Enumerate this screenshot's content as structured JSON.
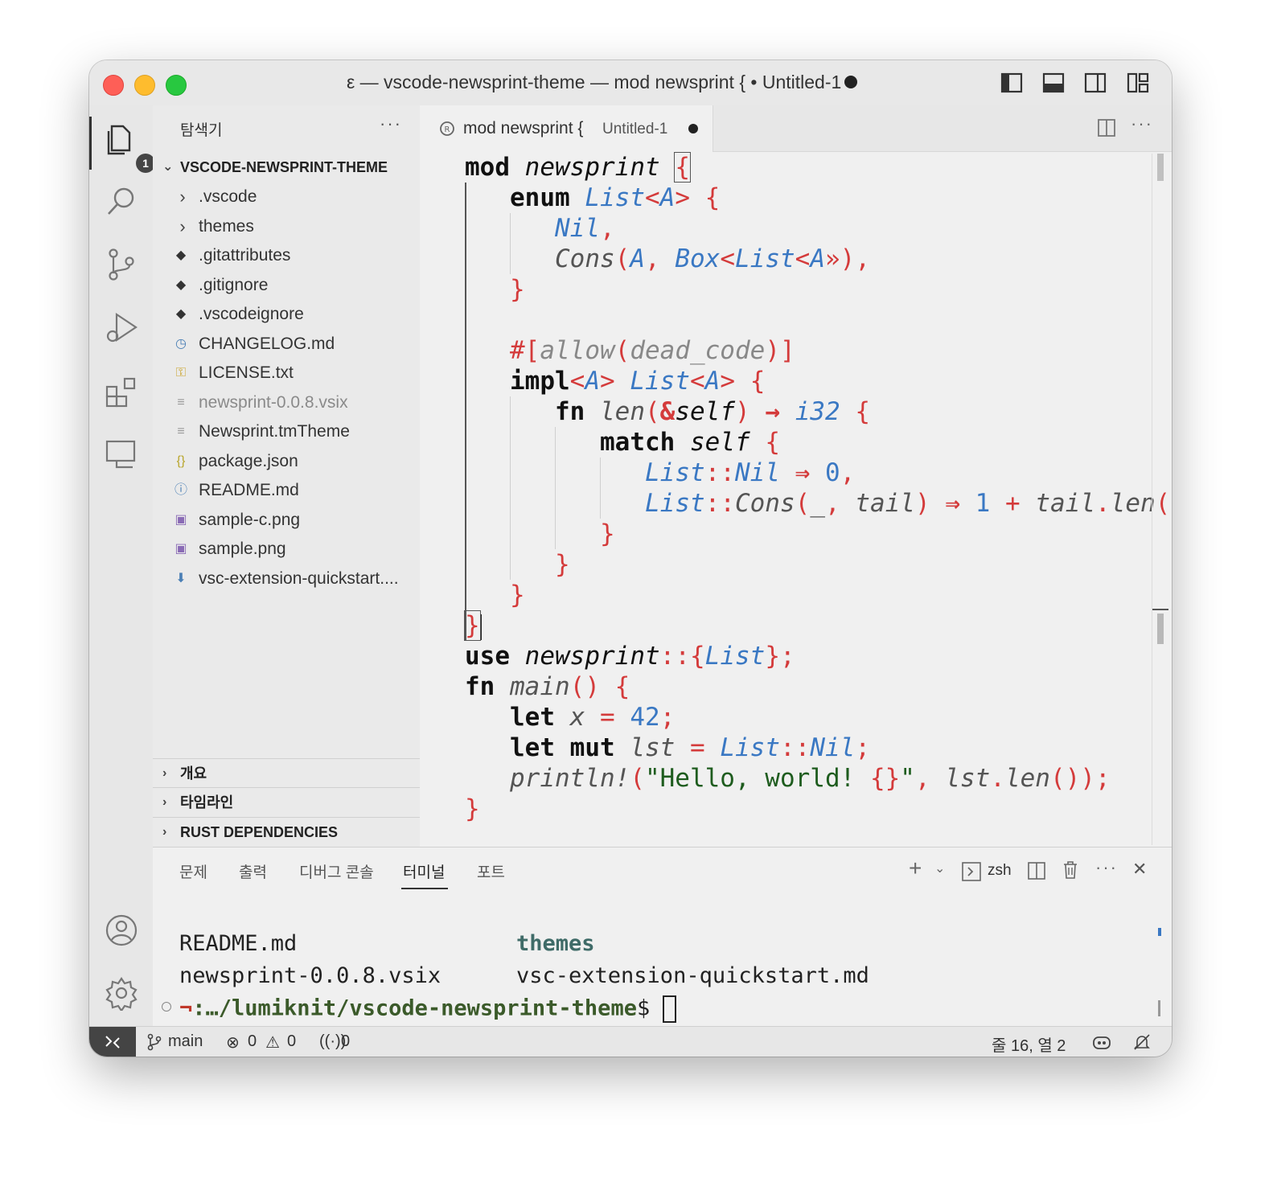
{
  "window": {
    "title": "ε — vscode-newsprint-theme — mod newsprint { • Untitled-1"
  },
  "activity_bar": {
    "explorer_badge": "1"
  },
  "sidebar": {
    "header": "탐색기",
    "more": "···",
    "project_title": "VSCODE-NEWSPRINT-THEME",
    "items": [
      {
        "label": ".vscode",
        "icon": "chevron-right-icon"
      },
      {
        "label": "themes",
        "icon": "chevron-right-icon"
      },
      {
        "label": ".gitattributes",
        "icon": "git-icon"
      },
      {
        "label": ".gitignore",
        "icon": "git-icon"
      },
      {
        "label": ".vscodeignore",
        "icon": "git-icon"
      },
      {
        "label": "CHANGELOG.md",
        "icon": "clock-icon"
      },
      {
        "label": "LICENSE.txt",
        "icon": "license-icon"
      },
      {
        "label": "newsprint-0.0.8.vsix",
        "icon": "file-lines-icon"
      },
      {
        "label": "Newsprint.tmTheme",
        "icon": "file-lines-icon"
      },
      {
        "label": "package.json",
        "icon": "braces-icon"
      },
      {
        "label": "README.md",
        "icon": "info-icon"
      },
      {
        "label": "sample-c.png",
        "icon": "image-icon"
      },
      {
        "label": "sample.png",
        "icon": "image-icon"
      },
      {
        "label": "vsc-extension-quickstart....",
        "icon": "download-icon"
      }
    ],
    "sections": [
      "개요",
      "타임라인",
      "RUST DEPENDENCIES"
    ]
  },
  "editor": {
    "tab_title": "mod newsprint {",
    "tab_subtitle": "Untitled-1"
  },
  "code": {
    "l1": [
      "mod",
      "newsprint",
      "{"
    ],
    "l2": [
      "enum",
      "List",
      "<",
      "A",
      ">",
      "{"
    ],
    "l3": [
      "Nil",
      ","
    ],
    "l4": [
      "Cons",
      "(",
      "A",
      ", ",
      "Box",
      "<",
      "List",
      "<",
      "A",
      "»",
      ")",
      ","
    ],
    "l5": [
      "}"
    ],
    "l7": [
      "#[",
      "allow",
      "(",
      "dead_code",
      ")]"
    ],
    "l8": [
      "impl",
      "<",
      "A",
      ">",
      "List",
      "<",
      "A",
      ">",
      "{"
    ],
    "l9": [
      "fn",
      "len",
      "(",
      "&",
      "self",
      ")",
      "→",
      "i32",
      "{"
    ],
    "l10": [
      "match",
      "self",
      "{"
    ],
    "l11": [
      "List",
      "::",
      "Nil",
      "⇒",
      "0",
      ","
    ],
    "l12": [
      "List",
      "::",
      "Cons",
      "(",
      "_",
      ", ",
      "tail",
      ")",
      "⇒",
      "1",
      "+",
      "tail",
      ".",
      "len",
      "()",
      ","
    ],
    "l13": [
      "}"
    ],
    "l14": [
      "}"
    ],
    "l15": [
      "}"
    ],
    "l16": [
      "}"
    ],
    "l17": [
      "use",
      "newsprint",
      "::",
      "{",
      "List",
      "};"
    ],
    "l18": [
      "fn",
      "main",
      "()",
      "{"
    ],
    "l19": [
      "let",
      "x",
      "=",
      "42",
      ";"
    ],
    "l20": [
      "let mut",
      "lst",
      "=",
      "List",
      "::",
      "Nil",
      ";"
    ],
    "l21": [
      "println!",
      "(",
      "\"Hello, world! ",
      "{}",
      "\"",
      ", ",
      "lst",
      ".",
      "len",
      "());"
    ],
    "l22": [
      "}"
    ]
  },
  "panel": {
    "tabs": [
      "문제",
      "출력",
      "디버그 콘솔",
      "터미널",
      "포트"
    ],
    "active_tab": "터미널",
    "shell": "zsh",
    "terminal": {
      "row1_col1": "README.md",
      "row1_col2": "themes",
      "row2_col1": "newsprint-0.0.8.vsix",
      "row2_col2": "vsc-extension-quickstart.md",
      "prompt_symbol": "¬",
      "prompt_path": ":…/lumiknit/vscode-newsprint-theme",
      "prompt_end": "$ "
    }
  },
  "statusbar": {
    "remote_icon": "remote-icon",
    "branch": "main",
    "errors": "0",
    "warnings": "0",
    "ports": "0",
    "cursor": "줄 16, 열 2"
  },
  "colors": {
    "keyword": "#111111",
    "type": "#3a78c3",
    "punct": "#d43b3b",
    "string": "#1e5c1e",
    "attribute": "#888888"
  }
}
